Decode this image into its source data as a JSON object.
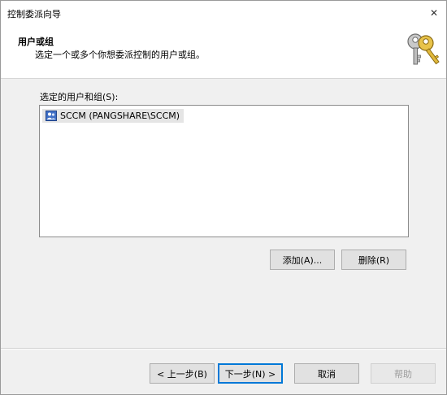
{
  "window": {
    "title": "控制委派向导",
    "close_glyph": "✕"
  },
  "header": {
    "title": "用户或组",
    "subtitle": "选定一个或多个你想委派控制的用户或组。",
    "icon": "keys-icon"
  },
  "selection": {
    "label": "选定的用户和组(S):",
    "items": [
      {
        "text": "SCCM (PANGSHARE\\SCCM)",
        "icon": "user-group-icon"
      }
    ]
  },
  "actions": {
    "add_label": "添加(A)...",
    "remove_label": "删除(R)"
  },
  "footer": {
    "back_label": "< 上一步(B)",
    "next_label": "下一步(N) >",
    "cancel_label": "取消",
    "help_label": "帮助"
  },
  "colors": {
    "accent": "#0078d7",
    "dialog_bg": "#f0f0f0"
  }
}
